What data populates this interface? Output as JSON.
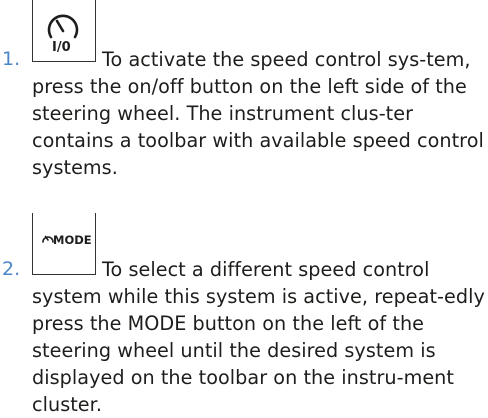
{
  "steps": [
    {
      "number": "1.",
      "icon": "speedometer-icon",
      "icon_label": "I/0",
      "text": "To activate the speed control sys-tem, press the on/off button on the left side of the steering wheel. The instrument clus-ter contains a toolbar with available speed control systems."
    },
    {
      "number": "2.",
      "icon": "mode-icon",
      "icon_label": "MODE",
      "text": "To select a different speed control system while this system is active, repeat-edly press the MODE button on the left of the steering wheel until the desired system is displayed on the toolbar on the instru-ment cluster."
    }
  ]
}
